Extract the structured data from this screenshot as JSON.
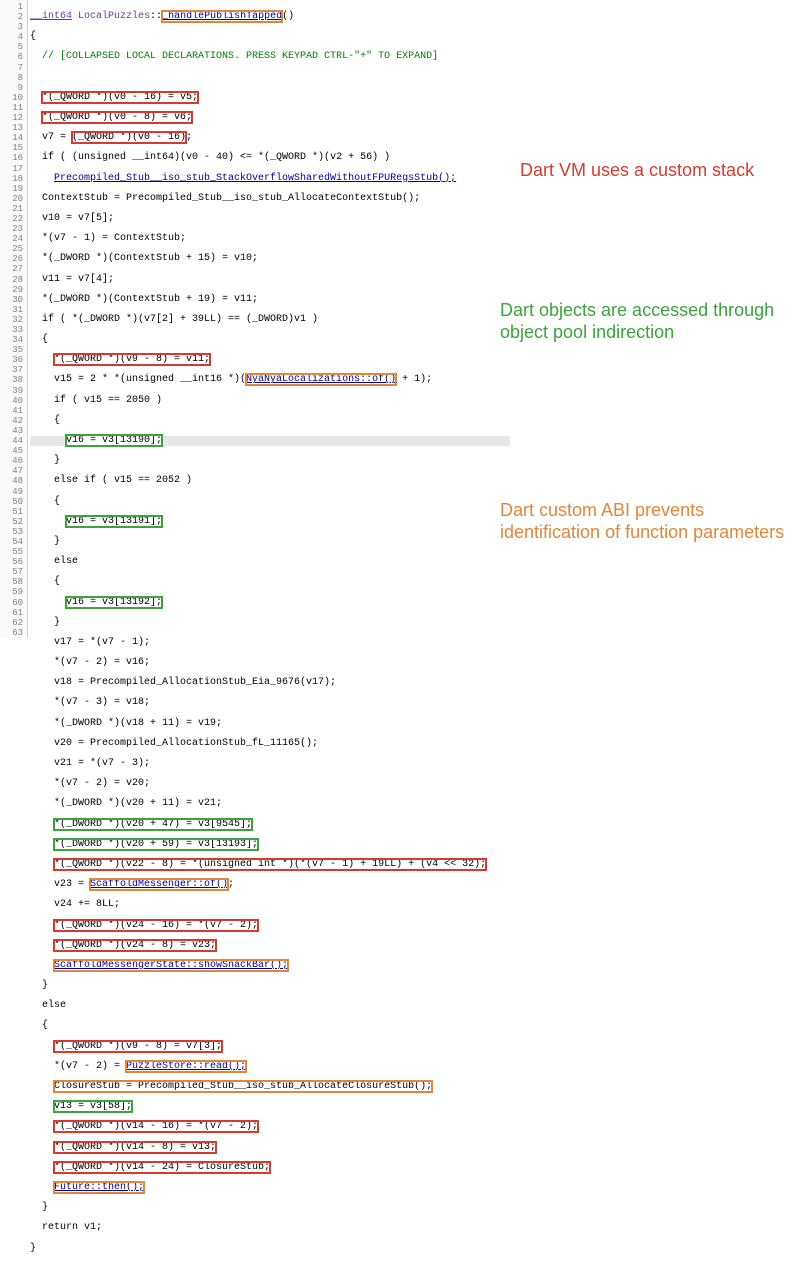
{
  "signature": {
    "ret_type": "__int64",
    "class": "LocalPuzzles",
    "fn": "_handlePublishTapped",
    "params": "()"
  },
  "fold_comment": "// [COLLAPSED LOCAL DECLARATIONS. PRESS KEYPAD CTRL-\"+\" TO EXPAND]",
  "annotations": {
    "stack": "Dart VM uses a custom stack",
    "pool": "Dart objects are accessed through object pool indirection",
    "abi": "Dart custom ABI prevents identification of function parameters"
  },
  "code": {
    "l5": "*(_QWORD *)(v0 - 16) = v5;",
    "l6": "*(_QWORD *)(v0 - 8) = v6;",
    "l7a": "v7 = ",
    "l7b": "(_QWORD *)(v0 - 16)",
    "l7c": ";",
    "l8": "if ( (unsigned __int64)(v0 - 40) <= *(_QWORD *)(v2 + 56) )",
    "l9": "Precompiled_Stub__iso_stub_StackOverflowSharedWithoutFPURegsStub();",
    "l10": "ContextStub = Precompiled_Stub__iso_stub_AllocateContextStub();",
    "l11": "v10 = v7[5];",
    "l12": "*(v7 - 1) = ContextStub;",
    "l13": "*(_DWORD *)(ContextStub + 15) = v10;",
    "l14": "v11 = v7[4];",
    "l15": "*(_DWORD *)(ContextStub + 19) = v11;",
    "l16": "if ( *(_DWORD *)(v7[2] + 39LL) == (_DWORD)v1 )",
    "l18a": "*(_QWORD *)(v9 - 8) = v11;",
    "l19a": "v15 = 2 * *(unsigned __int16 *)(",
    "l19b": "NyaNyaLocalizations::of()",
    "l19c": " + 1);",
    "l20": "if ( v15 == 2050 )",
    "l22": "v16 = v3[13190];",
    "l24": "else if ( v15 == 2052 )",
    "l26": "v16 = v3[13191];",
    "l30": "v16 = v3[13192];",
    "l32": "v17 = *(v7 - 1);",
    "l33": "*(v7 - 2) = v16;",
    "l34": "v18 = Precompiled_AllocationStub_Eia_9676(v17);",
    "l35": "*(v7 - 3) = v18;",
    "l36": "*(_DWORD *)(v18 + 11) = v19;",
    "l37": "v20 = Precompiled_AllocationStub_fL_11165();",
    "l38": "v21 = *(v7 - 3);",
    "l39": "*(v7 - 2) = v20;",
    "l40": "*(_DWORD *)(v20 + 11) = v21;",
    "l41": "*(_DWORD *)(v20 + 47) = v3[9545];",
    "l42": "*(_DWORD *)(v20 + 59) = v3[13193];",
    "l43": "*(_QWORD *)(v22 - 8) = *(unsigned int *)(*(v7 - 1) + 19LL) + (v4 << 32);",
    "l44": "v23 = ScaffoldMessenger::of();",
    "l45": "v24 += 8LL;",
    "l46": "*(_QWORD *)(v24 - 16) = *(v7 - 2);",
    "l47": "*(_QWORD *)(v24 - 8) = v23;",
    "l48": "ScaffoldMessengerState::showSnackBar();",
    "l52a": "*(_QWORD *)(v9 - 8) = v7[3];",
    "l53a": "*(v7 - 2) = ",
    "l53b": "PuzzleStore::read();",
    "l54": "ClosureStub = Precompiled_Stub__iso_stub_AllocateClosureStub();",
    "l55": "v13 = v3[58];",
    "l56": "*(_QWORD *)(v14 - 16) = *(v7 - 2);",
    "l57": "*(_QWORD *)(v14 - 8) = v13;",
    "l58": "*(_QWORD *)(v14 - 24) = ClosureStub;",
    "l59": "Future::then();",
    "l61": "return v1;"
  }
}
